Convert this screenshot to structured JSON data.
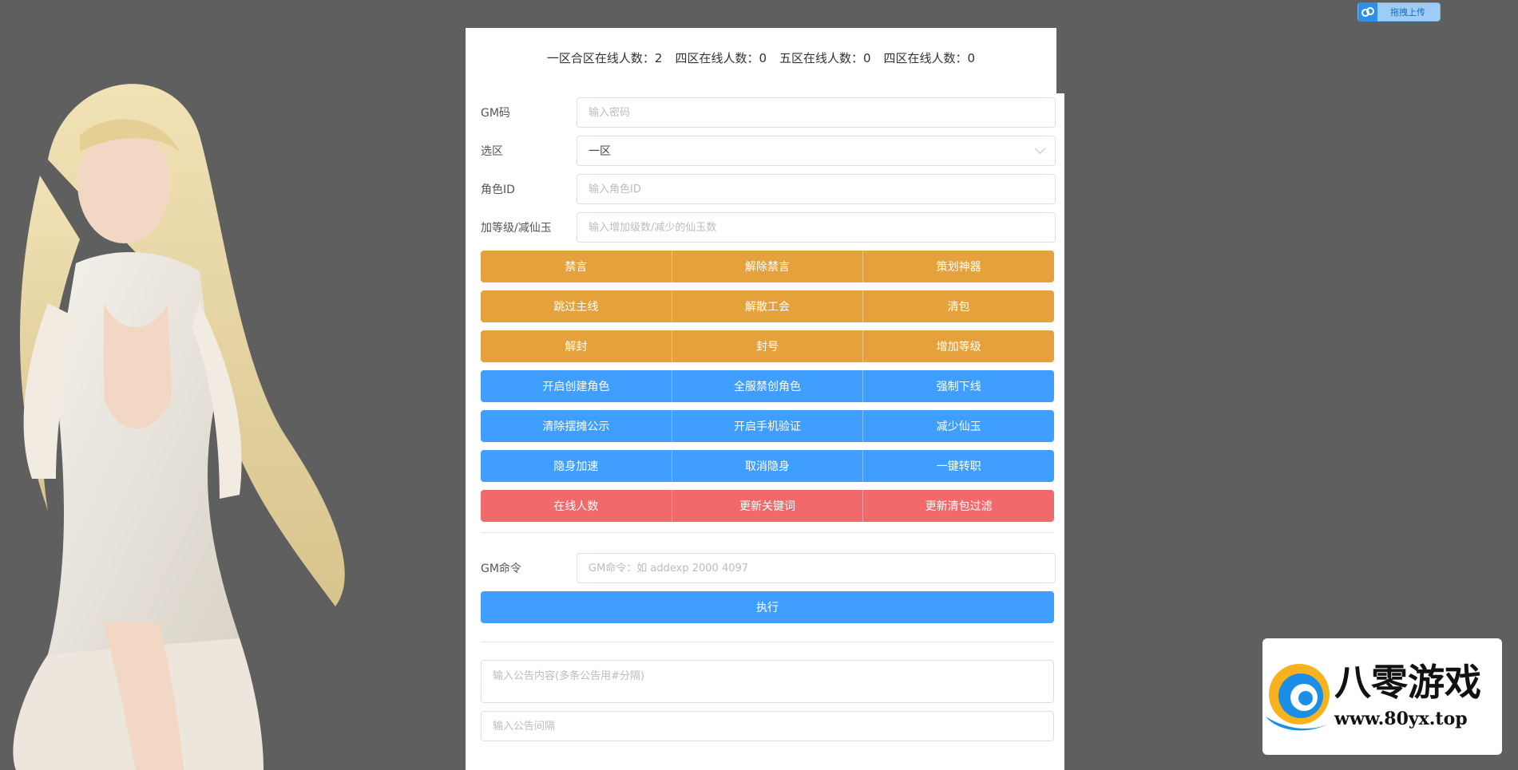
{
  "upload": {
    "label": "拖拽上传",
    "icon": "cloud-icon"
  },
  "online": {
    "zone1": "一区合区在线人数：2",
    "zone4": "四区在线人数：0",
    "zone5": "五区在线人数：0",
    "zone4b": "四区在线人数：0"
  },
  "form": {
    "gm_code": {
      "label": "GM码",
      "placeholder": "输入密码"
    },
    "zone": {
      "label": "选区",
      "value": "一区"
    },
    "role_id": {
      "label": "角色ID",
      "placeholder": "输入角色ID"
    },
    "level": {
      "label": "加等级/减仙玉",
      "placeholder": "输入增加级数/减少的仙玉数"
    }
  },
  "buttons": {
    "mute": "禁言",
    "unmute": "解除禁言",
    "artifact": "策划神器",
    "skip_main": "跳过主线",
    "disband_guild": "解散工会",
    "clear_bag": "清包",
    "unban": "解封",
    "ban": "封号",
    "add_level": "增加等级",
    "open_create": "开启创建角色",
    "ban_create": "全服禁创角色",
    "force_offline": "强制下线",
    "clear_stall": "清除摆摊公示",
    "phone_verify": "开启手机验证",
    "reduce_jade": "减少仙玉",
    "stealth_speed": "隐身加速",
    "cancel_stealth": "取消隐身",
    "one_click_job": "一键转职",
    "online_count": "在线人数",
    "update_keywords": "更新关键词",
    "update_bag_filter": "更新清包过滤"
  },
  "gm_command": {
    "label": "GM命令",
    "placeholder": "GM命令：如 addexp 2000 4097",
    "execute": "执行"
  },
  "announce": {
    "content_placeholder": "输入公告内容(多条公告用#分隔)",
    "interval_placeholder": "输入公告间隔"
  },
  "watermark": {
    "brand": "八零游戏",
    "url": "www.80yx.top"
  },
  "colors": {
    "orange": "#e5a23c",
    "blue": "#409eff",
    "red": "#f06a6b"
  }
}
